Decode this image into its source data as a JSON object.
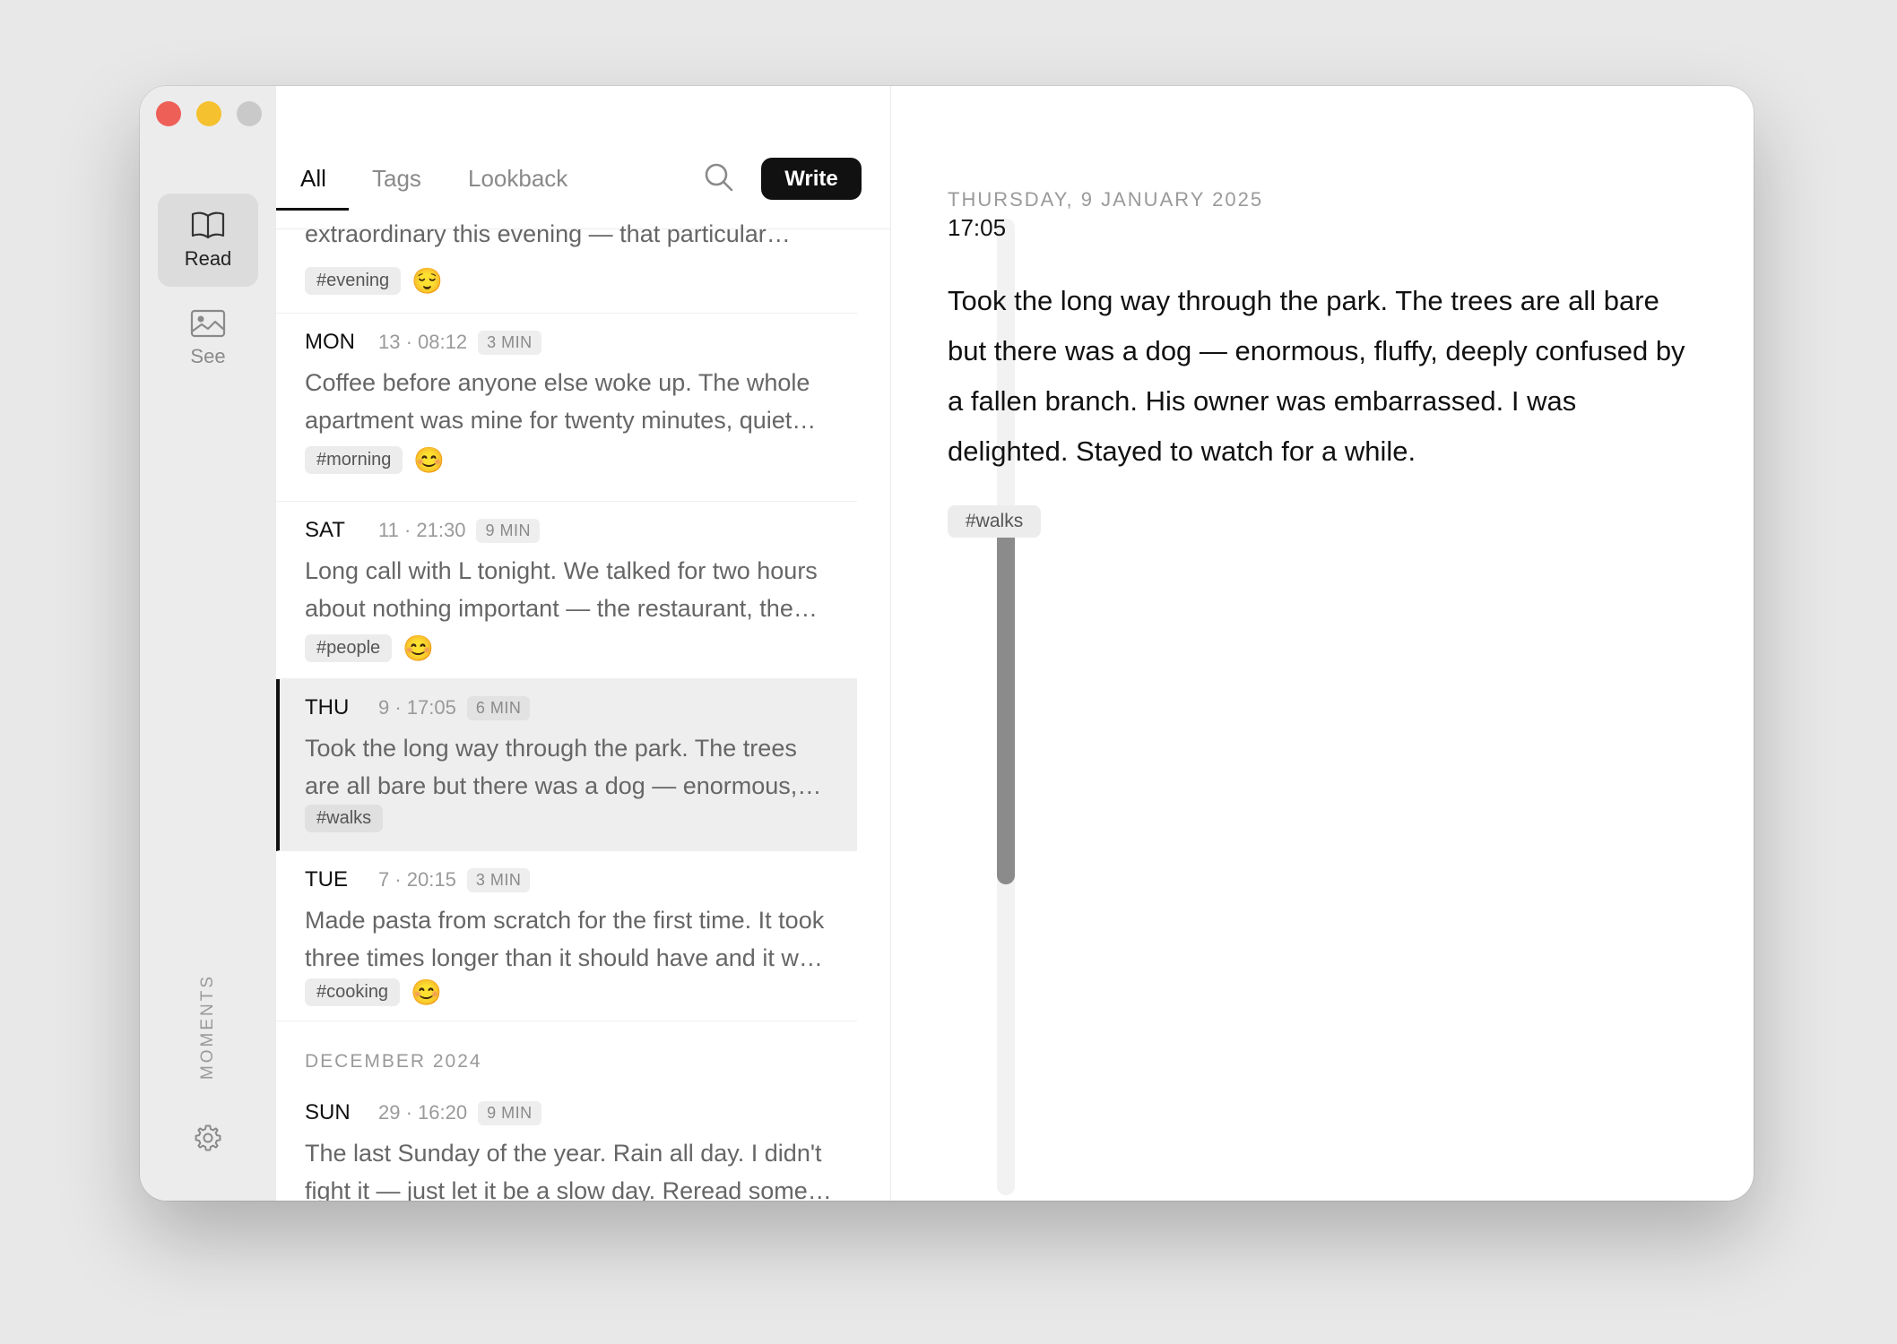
{
  "sidebar": {
    "read_label": "Read",
    "see_label": "See",
    "vertical_label": "MOMENTS"
  },
  "tabs": {
    "all": "All",
    "tags": "Tags",
    "lookback": "Lookback",
    "write_label": "Write"
  },
  "entries": [
    {
      "day": "",
      "time": "",
      "min": "",
      "text": "extraordinary this evening — that particular…",
      "tag": "#evening",
      "emoji": "😌"
    },
    {
      "day": "MON",
      "time": "13 · 08:12",
      "min": "3 MIN",
      "text": "Coffee before anyone else woke up. The whole apartment was mine for twenty minutes, quiet and still.",
      "tag": "#morning",
      "emoji": "😊"
    },
    {
      "day": "SAT",
      "time": "11 · 21:30",
      "min": "9 MIN",
      "text": "Long call with L tonight. We talked for two hours about nothing important — the restaurant, the weather.",
      "tag": "#people",
      "emoji": "😊"
    },
    {
      "day": "THU",
      "time": "9 · 17:05",
      "min": "6 MIN",
      "text": "Took the long way through the park. The trees are all bare but there was a dog — enormous, fluffy.",
      "tag": "#walks",
      "emoji": ""
    },
    {
      "day": "TUE",
      "time": "7 · 20:15",
      "min": "3 MIN",
      "text": "Made pasta from scratch for the first time. It took three times longer than it should have and it was perfect.",
      "tag": "#cooking",
      "emoji": "😊"
    },
    {
      "day": "SUN",
      "time": "29 · 16:20",
      "min": "9 MIN",
      "text": "The last Sunday of the year. Rain all day. I didn't fight it — just let it be a slow day. Reread some letters.",
      "tag": "",
      "emoji": ""
    }
  ],
  "month_divider": "DECEMBER 2024",
  "detail": {
    "date": "THURSDAY, 9 JANUARY 2025",
    "time": "17:05",
    "body": "Took the long way through the park. The trees are all bare but there was a dog — enormous, fluffy, deeply confused by a fallen branch. His owner was embarrassed. I was delighted. Stayed to watch for a while.",
    "tag": "#walks"
  },
  "colors": {
    "accent": "#111111",
    "close": "#ed5f57",
    "minimize": "#f5c12e",
    "maximize": "#c9c9c9"
  },
  "icons": [
    "book-icon",
    "image-icon",
    "gear-icon",
    "search-icon"
  ]
}
